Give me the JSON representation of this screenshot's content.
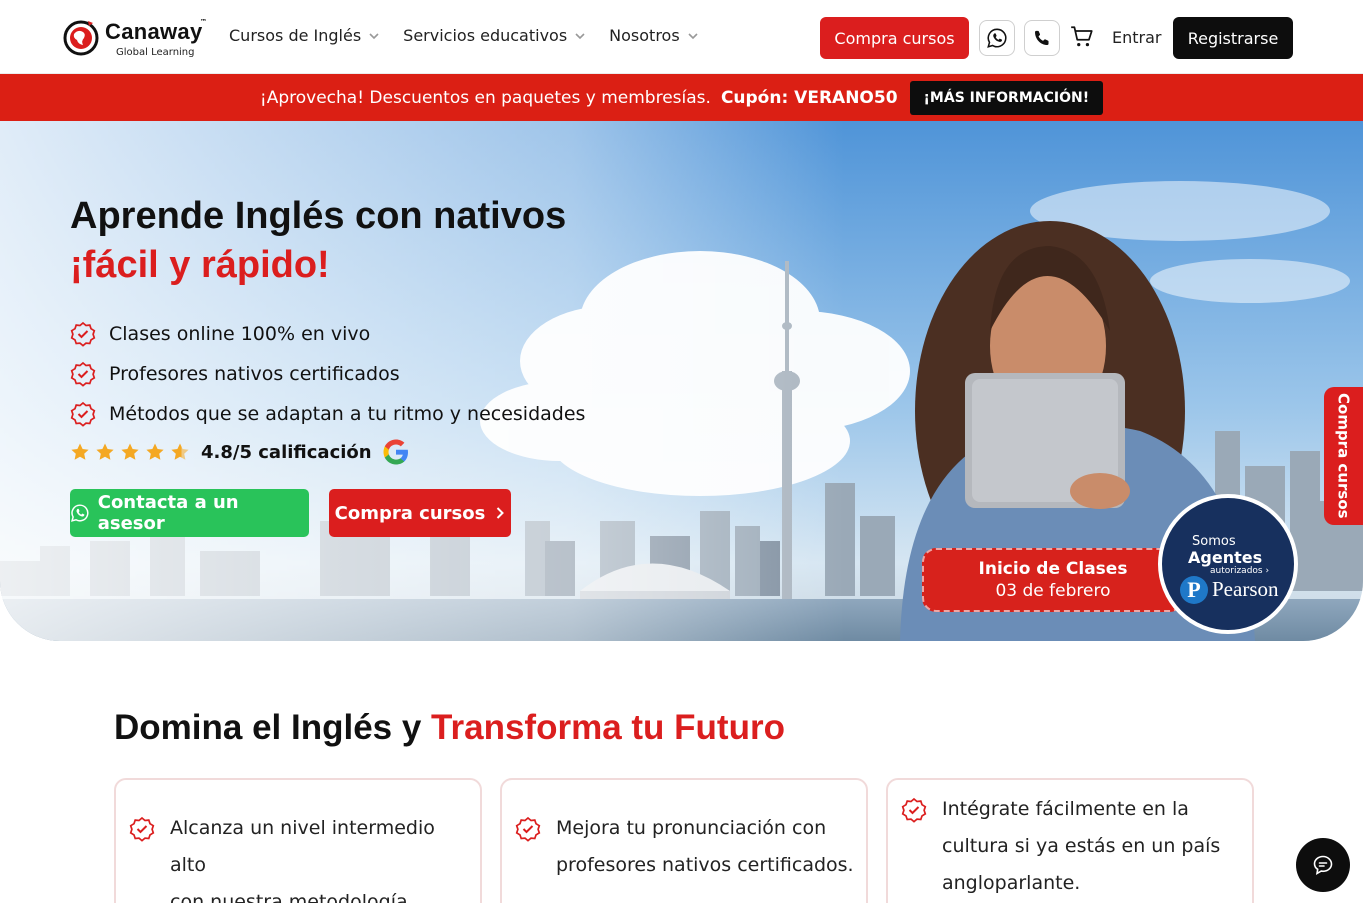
{
  "header": {
    "logo_name": "Canaway",
    "logo_tm": "™",
    "logo_sub": "Global Learning",
    "nav": [
      "Cursos de Inglés",
      "Servicios educativos",
      "Nosotros"
    ],
    "buy_label": "Compra cursos",
    "login_label": "Entrar",
    "register_label": "Registrarse"
  },
  "promo": {
    "text": "¡Aprovecha! Descuentos en paquetes y membresías.",
    "code": "Cupón: VERANO50",
    "button": "¡MÁS INFORMACIÓN!"
  },
  "hero": {
    "title": "Aprende Inglés con nativos",
    "title_accent": "¡fácil y rápido!",
    "features": [
      "Clases online 100% en vivo",
      "Profesores nativos certificados",
      "Métodos que se adaptan a tu ritmo y necesidades"
    ],
    "rating_value": 5,
    "rating_text": "4.8/5 calificación",
    "contact_button": "Contacta a un asesor",
    "buy_button": "Compra cursos",
    "start_title": "Inicio de Clases",
    "start_date": "03 de febrero",
    "pearson": {
      "somos": "Somos",
      "agentes": "Agentes",
      "autorizados": "autorizados",
      "name": "Pearson"
    },
    "side_tab": "Compra cursos"
  },
  "section": {
    "title_part1": "Domina el Inglés y",
    "title_part2": "Transforma tu Futuro",
    "cards": [
      {
        "line1": "Alcanza un nivel intermedio alto",
        "line2": "con nuestra metodología.",
        "line3": ""
      },
      {
        "line1": "Mejora tu pronunciación con",
        "line2": "profesores nativos certificados.",
        "line3": ""
      },
      {
        "line1": "Intégrate fácilmente en la",
        "line2": "cultura si ya estás en un país",
        "line3": "angloparlante."
      }
    ]
  },
  "colors": {
    "brand_red": "#db1e1e",
    "dark": "#0d0d0d",
    "whatsapp_green": "#29c35a",
    "pearson_navy": "#17305e"
  },
  "icons": [
    "globe-logo-icon",
    "chevron-down-icon",
    "whatsapp-icon",
    "phone-icon",
    "cart-icon",
    "check-badge-icon",
    "star-icon",
    "google-icon",
    "chevron-right-icon",
    "chat-icon"
  ]
}
